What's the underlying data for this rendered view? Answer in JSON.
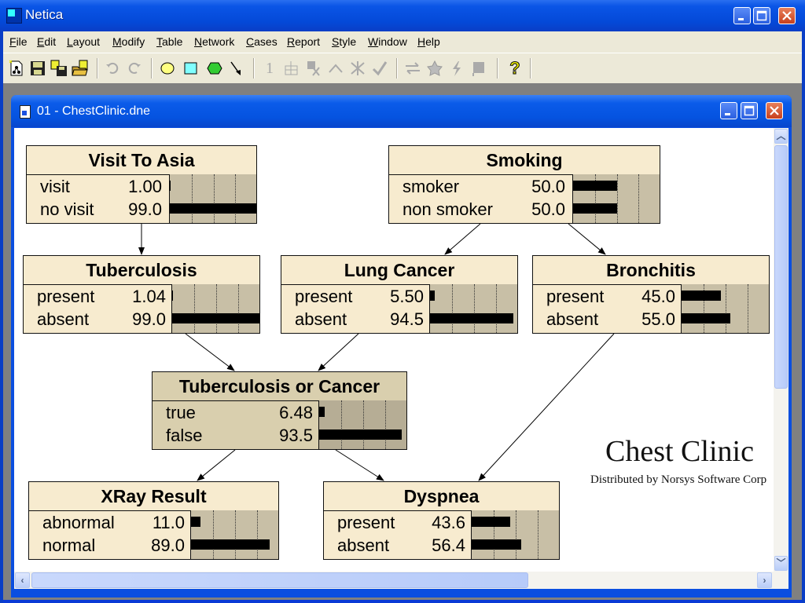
{
  "app": {
    "title": "Netica",
    "window_controls": [
      "minimize",
      "maximize",
      "close"
    ]
  },
  "menu": [
    {
      "label": "File",
      "accel": "F"
    },
    {
      "label": "Edit",
      "accel": "E"
    },
    {
      "label": "Layout",
      "accel": "L"
    },
    {
      "label": "Modify",
      "accel": "M"
    },
    {
      "label": "Table",
      "accel": "T"
    },
    {
      "label": "Network",
      "accel": "N"
    },
    {
      "label": "Cases",
      "accel": "C"
    },
    {
      "label": "Report",
      "accel": "R"
    },
    {
      "label": "Style",
      "accel": "S"
    },
    {
      "label": "Window",
      "accel": "W"
    },
    {
      "label": "Help",
      "accel": "H"
    }
  ],
  "toolbar": {
    "buttons": [
      {
        "icon": "new-network-icon",
        "enabled": true
      },
      {
        "icon": "save-icon",
        "enabled": true
      },
      {
        "icon": "save-all-icon",
        "enabled": true
      },
      {
        "icon": "open-folder-icon",
        "enabled": true
      },
      {
        "icon": "undo-icon",
        "enabled": false
      },
      {
        "icon": "redo-icon",
        "enabled": false
      },
      {
        "icon": "add-nature-node-icon",
        "enabled": true,
        "color": "#ffff80"
      },
      {
        "icon": "add-decision-node-icon",
        "enabled": true,
        "color": "#80ffff"
      },
      {
        "icon": "add-utility-node-icon",
        "enabled": true,
        "color": "#33cc33"
      },
      {
        "icon": "add-link-icon",
        "enabled": true
      },
      {
        "icon": "compile-icon",
        "enabled": false,
        "glyph": "1"
      },
      {
        "icon": "table-icon",
        "enabled": false
      },
      {
        "icon": "absorb-node-icon",
        "enabled": false
      },
      {
        "icon": "reverse-link-icon",
        "enabled": false
      },
      {
        "icon": "remove-findings-icon",
        "enabled": false
      },
      {
        "icon": "check-icon",
        "enabled": false
      },
      {
        "icon": "transform-icon",
        "enabled": false
      },
      {
        "icon": "star-icon",
        "enabled": false
      },
      {
        "icon": "lightning-icon",
        "enabled": false
      },
      {
        "icon": "flag-icon",
        "enabled": false
      },
      {
        "icon": "help-icon",
        "enabled": true,
        "glyph": "?"
      }
    ]
  },
  "document": {
    "title": "01 - ChestClinic.dne"
  },
  "network": {
    "title": "Chest Clinic",
    "subtitle": "Distributed by Norsys Software Corp",
    "nodes": [
      {
        "id": "visit-to-asia",
        "name": "Visit To Asia",
        "selected": false,
        "states": [
          {
            "label": "visit",
            "value": "1.00",
            "pct": 1.0
          },
          {
            "label": "no visit",
            "value": "99.0",
            "pct": 99.0
          }
        ]
      },
      {
        "id": "smoking",
        "name": "Smoking",
        "selected": false,
        "states": [
          {
            "label": "smoker",
            "value": "50.0",
            "pct": 50.0
          },
          {
            "label": "non smoker",
            "value": "50.0",
            "pct": 50.0
          }
        ]
      },
      {
        "id": "tuberculosis",
        "name": "Tuberculosis",
        "selected": false,
        "states": [
          {
            "label": "present",
            "value": "1.04",
            "pct": 1.04
          },
          {
            "label": "absent",
            "value": "99.0",
            "pct": 99.0
          }
        ]
      },
      {
        "id": "lung-cancer",
        "name": "Lung Cancer",
        "selected": false,
        "states": [
          {
            "label": "present",
            "value": "5.50",
            "pct": 5.5
          },
          {
            "label": "absent",
            "value": "94.5",
            "pct": 94.5
          }
        ]
      },
      {
        "id": "bronchitis",
        "name": "Bronchitis",
        "selected": false,
        "states": [
          {
            "label": "present",
            "value": "45.0",
            "pct": 45.0
          },
          {
            "label": "absent",
            "value": "55.0",
            "pct": 55.0
          }
        ]
      },
      {
        "id": "tuberculosis-or-cancer",
        "name": "Tuberculosis or Cancer",
        "selected": true,
        "states": [
          {
            "label": "true",
            "value": "6.48",
            "pct": 6.48
          },
          {
            "label": "false",
            "value": "93.5",
            "pct": 93.5
          }
        ]
      },
      {
        "id": "xray-result",
        "name": "XRay Result",
        "selected": false,
        "states": [
          {
            "label": "abnormal",
            "value": "11.0",
            "pct": 11.0
          },
          {
            "label": "normal",
            "value": "89.0",
            "pct": 89.0
          }
        ]
      },
      {
        "id": "dyspnea",
        "name": "Dyspnea",
        "selected": false,
        "states": [
          {
            "label": "present",
            "value": "43.6",
            "pct": 43.6
          },
          {
            "label": "absent",
            "value": "56.4",
            "pct": 56.4
          }
        ]
      }
    ],
    "links": [
      {
        "from": "visit-to-asia",
        "to": "tuberculosis"
      },
      {
        "from": "smoking",
        "to": "lung-cancer"
      },
      {
        "from": "smoking",
        "to": "bronchitis"
      },
      {
        "from": "tuberculosis",
        "to": "tuberculosis-or-cancer"
      },
      {
        "from": "lung-cancer",
        "to": "tuberculosis-or-cancer"
      },
      {
        "from": "bronchitis",
        "to": "dyspnea"
      },
      {
        "from": "tuberculosis-or-cancer",
        "to": "xray-result"
      },
      {
        "from": "tuberculosis-or-cancer",
        "to": "dyspnea"
      }
    ]
  }
}
